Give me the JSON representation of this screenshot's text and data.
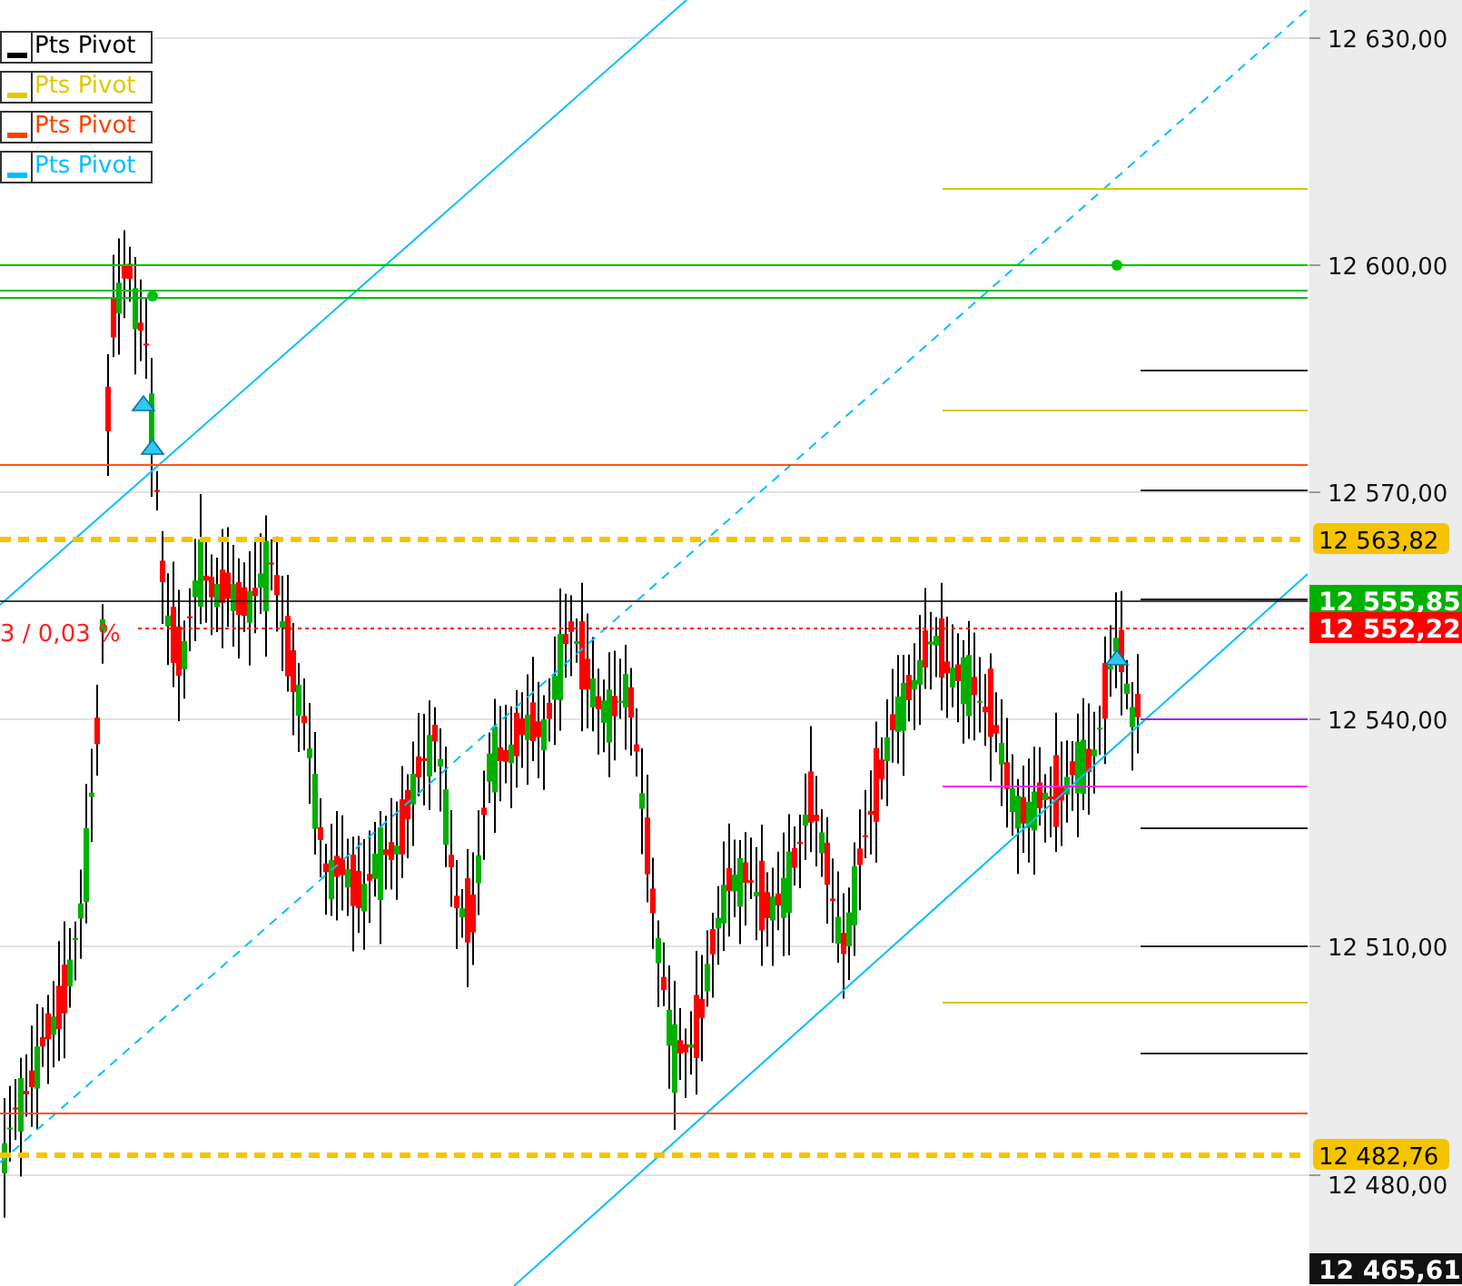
{
  "legend": [
    {
      "label": "Pts Pivot",
      "color": "#000000"
    },
    {
      "label": "Pts Pivot",
      "color": "#e0c800"
    },
    {
      "label": "Pts Pivot",
      "color": "#ff4000"
    },
    {
      "label": "Pts Pivot",
      "color": "#00bfff"
    }
  ],
  "change_label": "3 / 0,03 %",
  "price_axis": {
    "ticks": [
      "12 630,00",
      "12 600,00",
      "12 570,00",
      "12 540,00",
      "12 510,00",
      "12 480,00"
    ]
  },
  "price_tags": [
    {
      "label": "12 563,82",
      "kind": "level",
      "color": "#f5c400"
    },
    {
      "label": "12 555,85",
      "kind": "last",
      "color": "#00b000"
    },
    {
      "label": "12 552,22",
      "kind": "last",
      "color": "#ff0000"
    },
    {
      "label": "12 482,76",
      "kind": "level",
      "color": "#f5c400"
    },
    {
      "label": "12 465,61",
      "kind": "last",
      "color": "#111111"
    }
  ]
}
